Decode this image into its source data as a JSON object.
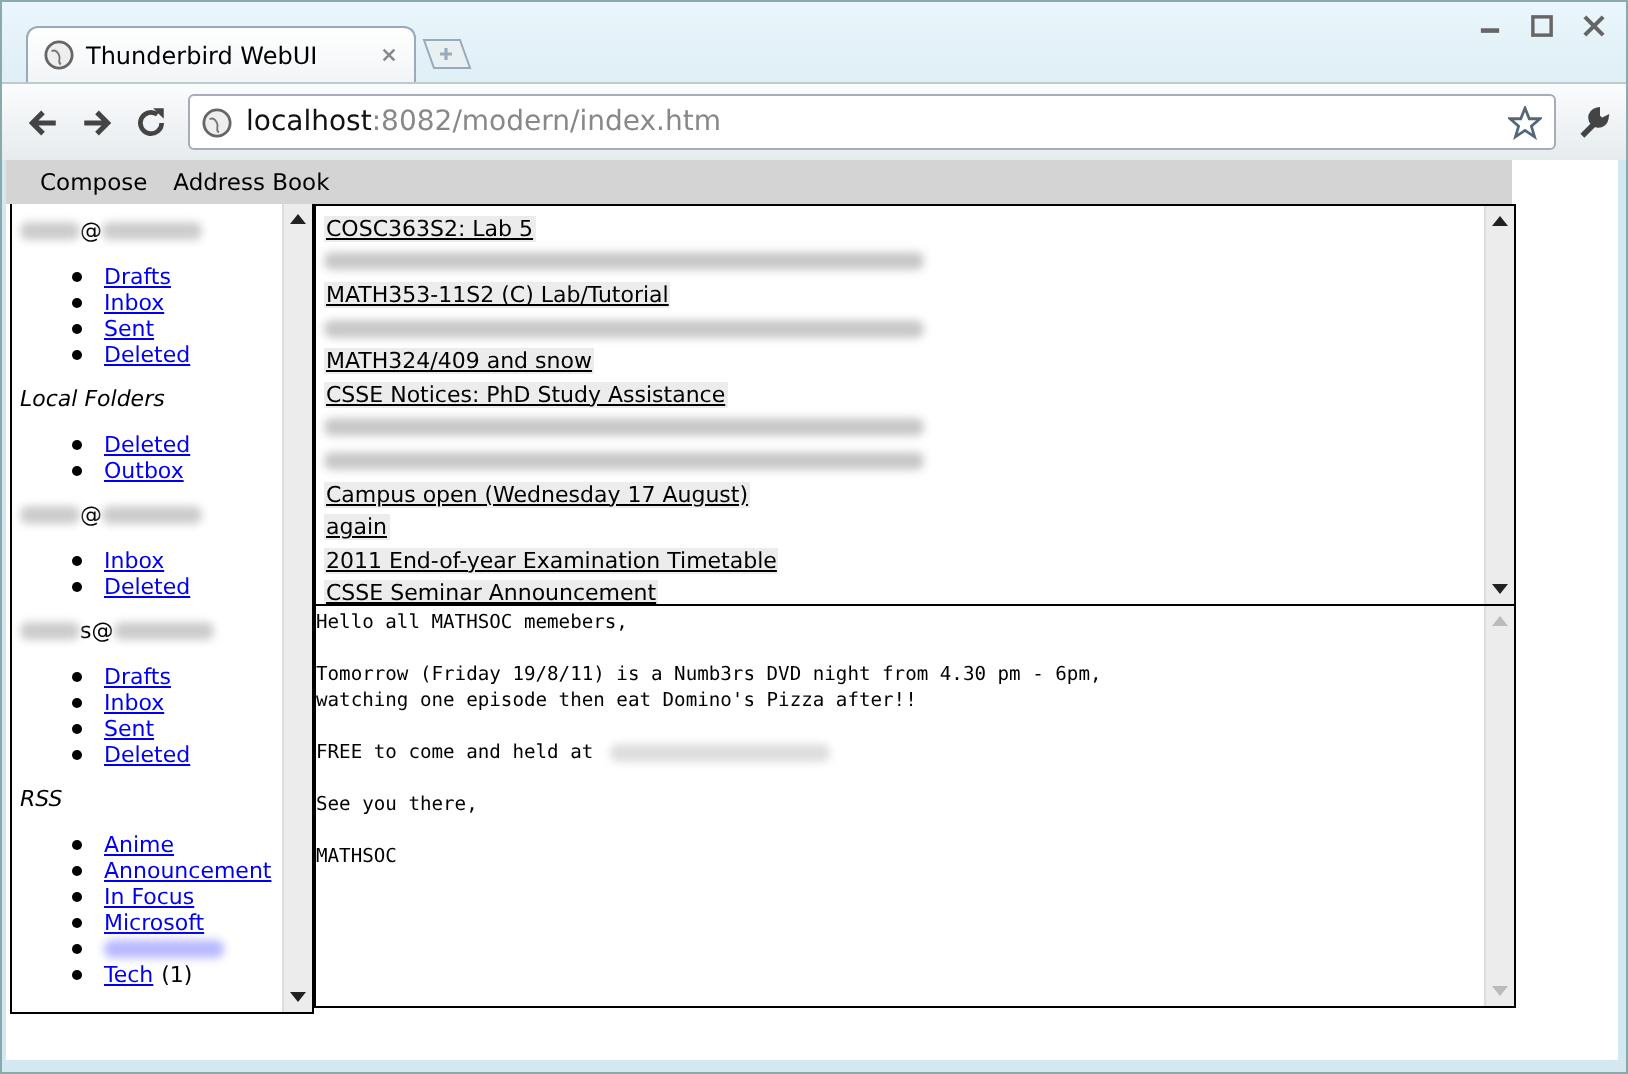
{
  "window": {
    "tab_title": "Thunderbird WebUI",
    "url_host": "localhost",
    "url_rest": ":8082/modern/index.htm"
  },
  "menu": [
    "Compose",
    "Address Book"
  ],
  "sidebar": {
    "sections": [
      {
        "kind": "account",
        "heading": "@",
        "folders": [
          {
            "label": "Drafts"
          },
          {
            "label": "Inbox"
          },
          {
            "label": "Sent"
          },
          {
            "label": "Deleted"
          }
        ]
      },
      {
        "kind": "local",
        "heading": "Local Folders",
        "folders": [
          {
            "label": "Deleted"
          },
          {
            "label": "Outbox"
          }
        ]
      },
      {
        "kind": "account",
        "heading": "@",
        "folders": [
          {
            "label": "Inbox"
          },
          {
            "label": "Deleted"
          }
        ]
      },
      {
        "kind": "account",
        "heading": "s@",
        "folders": [
          {
            "label": "Drafts"
          },
          {
            "label": "Inbox"
          },
          {
            "label": "Sent"
          },
          {
            "label": "Deleted"
          }
        ]
      },
      {
        "kind": "local",
        "heading": "RSS",
        "folders": [
          {
            "label": "Anime"
          },
          {
            "label": "Announcement"
          },
          {
            "label": "In Focus"
          },
          {
            "label": "Microsoft"
          },
          {
            "kind": "redacted"
          },
          {
            "label": "Tech",
            "count": "(1)"
          }
        ]
      }
    ]
  },
  "messages": [
    {
      "kind": "subject",
      "subject": "COSC363S2: Lab 5"
    },
    {
      "kind": "redacted"
    },
    {
      "kind": "subject",
      "subject": "MATH353-11S2 (C) Lab/Tutorial"
    },
    {
      "kind": "redacted"
    },
    {
      "kind": "subject",
      "subject": "MATH324/409 and snow"
    },
    {
      "kind": "subject",
      "subject": "CSSE Notices: PhD Study Assistance"
    },
    {
      "kind": "redacted"
    },
    {
      "kind": "redacted"
    },
    {
      "kind": "subject",
      "subject": "Campus open (Wednesday 17 August)"
    },
    {
      "kind": "subject",
      "subject": "again"
    },
    {
      "kind": "subject",
      "subject": "2011 End-of-year Examination Timetable"
    },
    {
      "kind": "subject",
      "subject": "CSSE Seminar Announcement"
    }
  ],
  "message_body": [
    {
      "kind": "text",
      "text": "Hello all MATHSOC memebers,"
    },
    {
      "kind": "blank"
    },
    {
      "kind": "text",
      "text": "Tomorrow (Friday 19/8/11) is a Numb3rs DVD night from 4.30 pm - 6pm,"
    },
    {
      "kind": "text",
      "text": "watching one episode then eat Domino's Pizza after!!"
    },
    {
      "kind": "blank"
    },
    {
      "kind": "text_redacted_tail",
      "text": "FREE to come and held at"
    },
    {
      "kind": "blank"
    },
    {
      "kind": "text",
      "text": "See you there,"
    },
    {
      "kind": "blank"
    },
    {
      "kind": "text",
      "text": "MATHSOC"
    }
  ]
}
